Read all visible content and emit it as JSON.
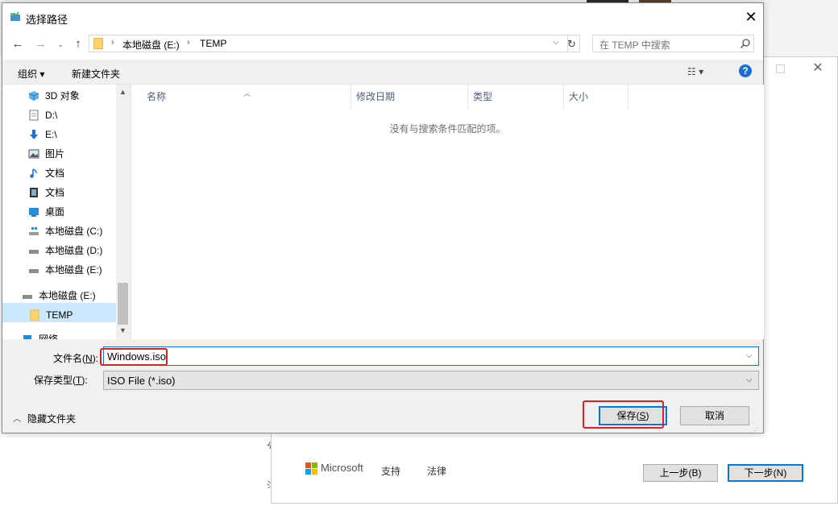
{
  "background_window": {
    "footer": {
      "brand": "Microsoft",
      "links": [
        "支持",
        "法律"
      ]
    },
    "buttons": {
      "prev": "上一步(B)",
      "next": "下一步(N)"
    },
    "fragments": [
      "分",
      "注"
    ]
  },
  "dialog": {
    "title": "选择路径",
    "close_icon": "✕",
    "address": {
      "breadcrumb": [
        "本地磁盘 (E:)",
        "TEMP"
      ]
    },
    "search_placeholder": "在 TEMP 中搜索",
    "toolbar": {
      "organize": "组织 ▾",
      "new_folder": "新建文件夹",
      "help": "?"
    },
    "sidebar": {
      "items": [
        {
          "label": "3D 对象",
          "icon": "cube-icon"
        },
        {
          "label": "D:\\",
          "icon": "document-icon"
        },
        {
          "label": "E:\\",
          "icon": "download-arrow-icon"
        },
        {
          "label": "图片",
          "icon": "picture-icon"
        },
        {
          "label": "文档",
          "icon": "music-icon"
        },
        {
          "label": "文档",
          "icon": "film-icon"
        },
        {
          "label": "桌面",
          "icon": "desktop-icon"
        },
        {
          "label": "本地磁盘 (C:)",
          "icon": "drive-os-icon"
        },
        {
          "label": "本地磁盘 (D:)",
          "icon": "drive-icon"
        },
        {
          "label": "本地磁盘 (E:)",
          "icon": "drive-icon"
        },
        {
          "label": "本地磁盘 (E:)",
          "icon": "drive-icon"
        },
        {
          "label": "TEMP",
          "icon": "folder-icon",
          "selected": true
        },
        {
          "label": "网络",
          "icon": "network-icon"
        }
      ]
    },
    "file_list": {
      "columns": [
        "名称",
        "修改日期",
        "类型",
        "大小"
      ],
      "empty_message": "没有与搜索条件匹配的项。"
    },
    "filename_label_text": "文件名",
    "filename_label_key": "N",
    "filename_value": "Windows.iso",
    "filetype_label_text": "保存类型",
    "filetype_label_key": "T",
    "filetype_value": "ISO File (*.iso)",
    "hide_folders": "隐藏文件夹",
    "save_text": "保存",
    "save_key": "S",
    "cancel": "取消"
  },
  "colors": {
    "accent": "#0078d7",
    "highlight_box": "#e02020",
    "selection": "#cce8ff"
  }
}
